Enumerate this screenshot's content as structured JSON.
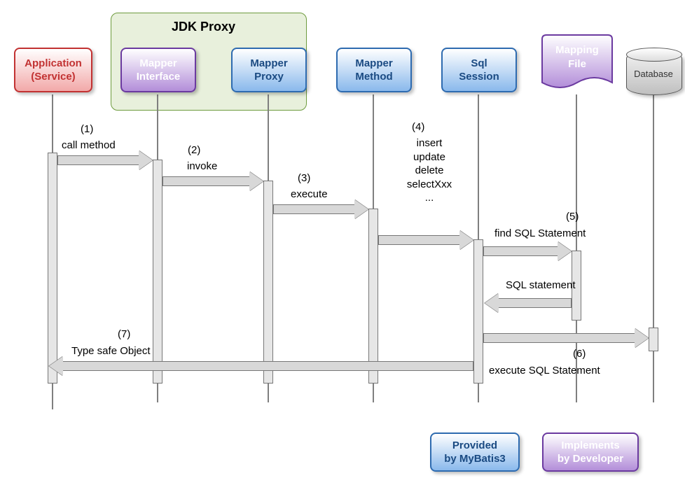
{
  "group": {
    "label": "JDK Proxy"
  },
  "participants": {
    "app": {
      "label": "Application\n(Service)"
    },
    "iface": {
      "label": "Mapper\nInterface"
    },
    "proxy": {
      "label": "Mapper\nProxy"
    },
    "method": {
      "label": "Mapper\nMethod"
    },
    "session": {
      "label": "Sql\nSession"
    },
    "mapfile": {
      "label": "Mapping\nFile"
    },
    "db": {
      "label": "Database"
    }
  },
  "steps": {
    "s1_num": "(1)",
    "s1": "call method",
    "s2_num": "(2)",
    "s2": "invoke",
    "s3_num": "(3)",
    "s3": "execute",
    "s4_num": "(4)",
    "s4": "insert\nupdate\ndelete\nselectXxx\n...",
    "s5_num": "(5)",
    "s5": "find SQL Statement",
    "s5r": "SQL statement",
    "s6_num": "(6)",
    "s6": "execute SQL Statement",
    "s7_num": "(7)",
    "s7": "Type safe Object"
  },
  "legend": {
    "provided": "Provided\nby MyBatis3",
    "developed": "Implements\nby Developer"
  }
}
